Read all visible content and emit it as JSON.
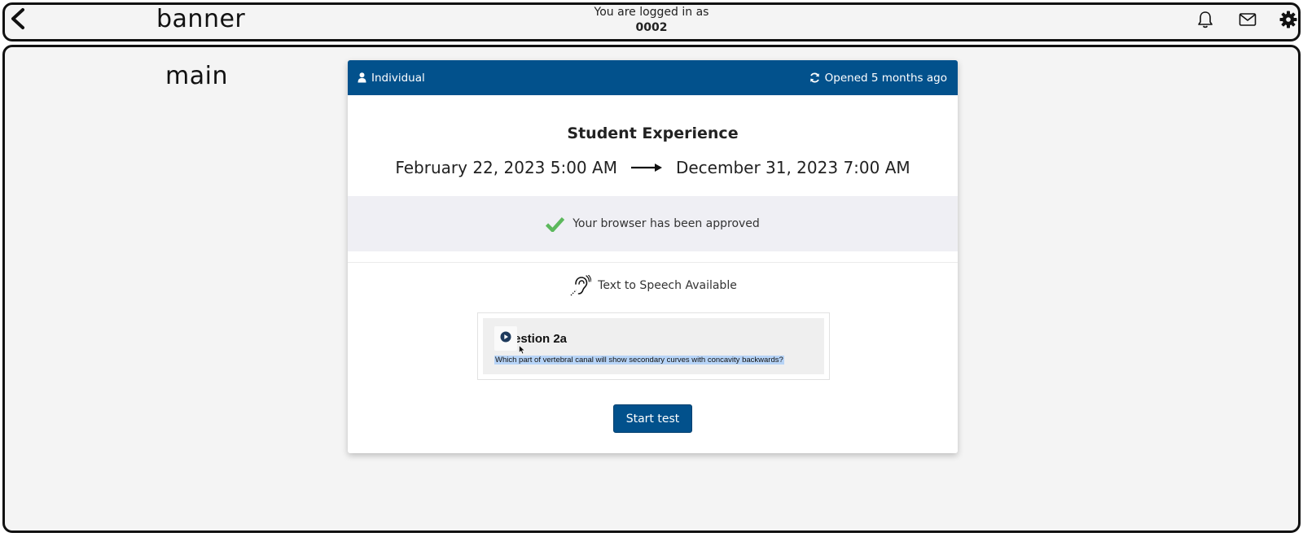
{
  "regions": {
    "banner_label": "banner",
    "main_label": "main"
  },
  "header": {
    "logged_in_text": "You are logged in as",
    "user_id": "0002"
  },
  "icons": {
    "back": "chevron-left-icon",
    "bell": "bell-icon",
    "mail": "mail-icon",
    "settings": "gear-icon"
  },
  "card": {
    "header_left": "Individual",
    "header_right": "Opened 5 months ago",
    "title": "Student Experience",
    "start_date": "February 22, 2023 5:00 AM",
    "end_date": "December 31, 2023 7:00 AM",
    "browser_status": "Your browser has been approved",
    "tts_label": "Text to Speech Available",
    "preview": {
      "title": "estion 2a",
      "question": "Which part of vertebral canal will show secondary curves with concavity backwards?"
    },
    "start_button": "Start test"
  },
  "colors": {
    "primary": "#02518c",
    "success": "#5cb85c",
    "band": "#efeff4",
    "highlight": "#b7d4f7"
  }
}
